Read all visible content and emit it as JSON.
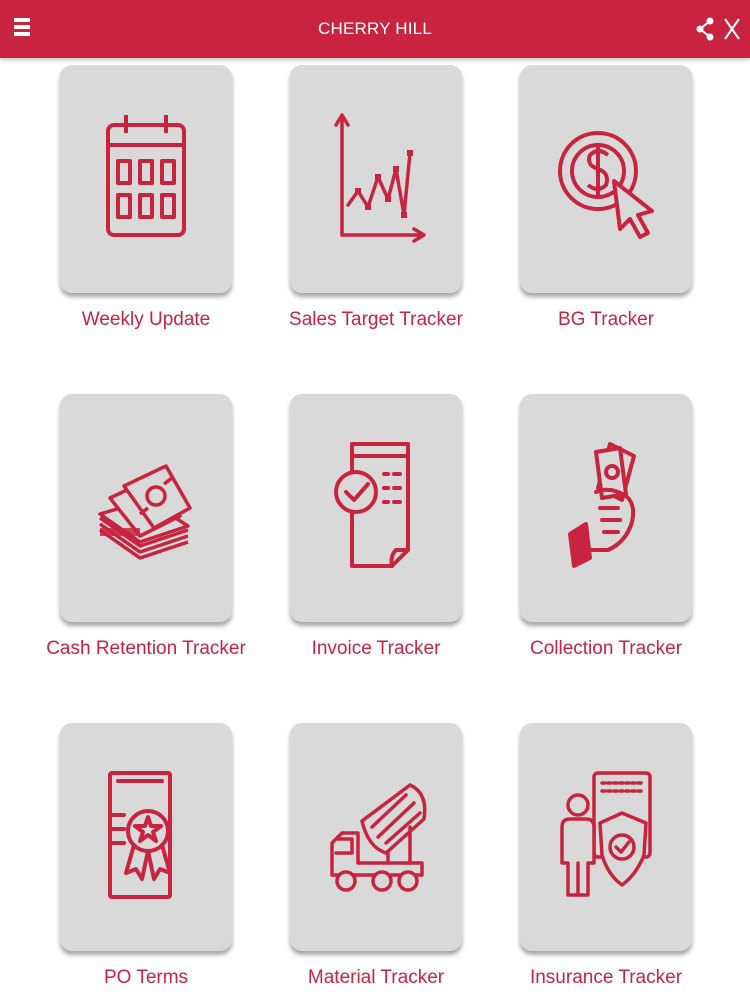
{
  "header": {
    "title": "CHERRY HILL",
    "menu_icon": "hamburger-menu-icon",
    "share_icon": "share-icon",
    "close_icon": "close-icon",
    "bar_color": "#c8233f"
  },
  "tiles": [
    {
      "label": "Weekly Update",
      "icon": "calendar-icon"
    },
    {
      "label": "Sales Target Tracker",
      "icon": "line-chart-icon"
    },
    {
      "label": "BG Tracker",
      "icon": "dollar-coin-cursor-icon"
    },
    {
      "label": "Cash Retention Tracker",
      "icon": "cash-stack-icon"
    },
    {
      "label": "Invoice Tracker",
      "icon": "invoice-check-icon"
    },
    {
      "label": "Collection Tracker",
      "icon": "hand-with-cash-icon"
    },
    {
      "label": "PO Terms",
      "icon": "certificate-icon"
    },
    {
      "label": "Material Tracker",
      "icon": "concrete-mixer-truck-icon"
    },
    {
      "label": "Insurance Tracker",
      "icon": "person-shield-icon"
    }
  ],
  "colors": {
    "accent": "#c8233f",
    "tile_background": "#d9d9d9"
  }
}
